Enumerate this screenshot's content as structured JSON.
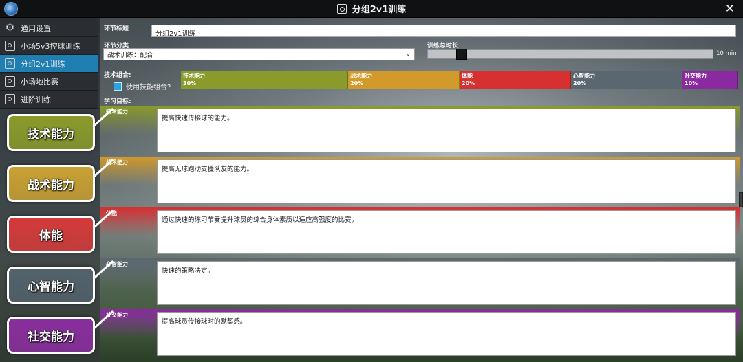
{
  "window": {
    "title": "分组2v1训练",
    "close_label": "✕"
  },
  "sidebar": {
    "items": [
      {
        "label": "通用设置",
        "icon": "gear-icon",
        "active": false
      },
      {
        "label": "小场5v3控球训练",
        "icon": "drill-icon",
        "active": false
      },
      {
        "label": "分组2v1训练",
        "icon": "drill-icon",
        "active": true
      },
      {
        "label": "小场地比赛",
        "icon": "drill-icon",
        "active": false
      },
      {
        "label": "进阶训练",
        "icon": "drill-icon",
        "active": false
      }
    ]
  },
  "form": {
    "section_title_label": "环节标题",
    "section_title_value": "分组2v1训练",
    "category_label": "环节分类",
    "category_value": "战术训练：配合",
    "duration_label": "训练总时长",
    "duration_value": "10 min",
    "duration_fraction": 0.1,
    "skill_combo_label": "技术组合:",
    "use_skill_combo_label": "使用技能组合?",
    "use_skill_combo_checked": true,
    "goals_label": "学习目标:"
  },
  "skills": [
    {
      "name": "技术能力",
      "percent": "30%",
      "fraction": 0.3,
      "color": "#8a9b2b"
    },
    {
      "name": "战术能力",
      "percent": "20%",
      "fraction": 0.2,
      "color": "#d19a2a"
    },
    {
      "name": "体能",
      "percent": "20%",
      "fraction": 0.2,
      "color": "#d63031"
    },
    {
      "name": "心智能力",
      "percent": "20%",
      "fraction": 0.2,
      "color": "#5a6770"
    },
    {
      "name": "社交能力",
      "percent": "10%",
      "fraction": 0.1,
      "color": "#8b2aa0"
    }
  ],
  "goals": [
    {
      "name": "技术能力",
      "text": "提高快速传接球的能力。",
      "color": "#8a9b2b"
    },
    {
      "name": "战术能力",
      "text": "提高无球跑动支援队友的能力。",
      "color": "#d19a2a"
    },
    {
      "name": "体能",
      "text": "通过快速的练习节奏提升球员的综合身体素质以适应高强度的比赛。",
      "color": "#d63031"
    },
    {
      "name": "心智能力",
      "text": "快速的策略决定。",
      "color": "#5a6770"
    },
    {
      "name": "社交能力",
      "text": "提高球员传接球时的默契感。",
      "color": "#8b2aa0"
    }
  ],
  "callouts": [
    {
      "label": "技术能力",
      "color": "#8a9b2b"
    },
    {
      "label": "战术能力",
      "color": "#c9a133"
    },
    {
      "label": "体能",
      "color": "#d43a3a"
    },
    {
      "label": "心智能力",
      "color": "#52626b"
    },
    {
      "label": "社交能力",
      "color": "#8a2e9e"
    }
  ]
}
